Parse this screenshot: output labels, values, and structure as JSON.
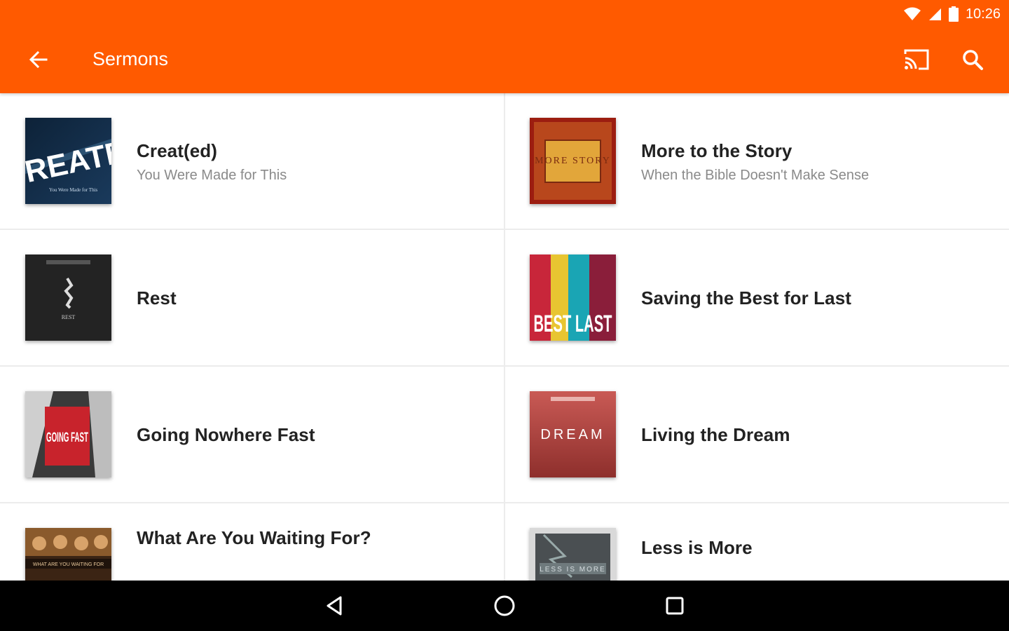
{
  "status_bar": {
    "time": "10:26"
  },
  "toolbar": {
    "title": "Sermons",
    "icons": [
      "back-arrow-icon",
      "cast-icon",
      "search-icon"
    ]
  },
  "colors": {
    "accent": "#ff5a00",
    "title_text": "#222222",
    "subtitle_text": "#8a8a8a"
  },
  "sermons": [
    {
      "title": "Creat(ed)",
      "subtitle": "You Were Made for This",
      "art_text": "REATE",
      "art_caption": "You Were Made for This"
    },
    {
      "title": "More to the Story",
      "subtitle": "When the Bible Doesn't Make Sense",
      "art_text": "MORE STORY"
    },
    {
      "title": "Rest",
      "subtitle": "",
      "art_text": "REST"
    },
    {
      "title": "Saving the Best for Last",
      "subtitle": "",
      "art_text": "BEST LAST"
    },
    {
      "title": "Going Nowhere Fast",
      "subtitle": "",
      "art_text": "GOING FAST"
    },
    {
      "title": "Living the Dream",
      "subtitle": "",
      "art_text": "DREAM"
    },
    {
      "title": "What Are You Waiting For?",
      "subtitle": "",
      "art_text": "WHAT ARE YOU WAITING FOR"
    },
    {
      "title": "Less is More",
      "subtitle": "",
      "art_text": "LESS IS MORE"
    }
  ],
  "nav_bar": {
    "icons": [
      "back-triangle-icon",
      "home-circle-icon",
      "recents-square-icon"
    ]
  }
}
